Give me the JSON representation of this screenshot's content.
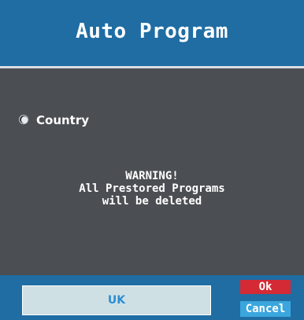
{
  "dialog": {
    "title": "Auto Program"
  },
  "options": {
    "country_label": "Country"
  },
  "warning": {
    "line1": "WARNING!",
    "line2": "All Prestored Programs",
    "line3": "will be deleted"
  },
  "footer": {
    "country_value": "UK",
    "ok_label": "Ok",
    "cancel_label": "Cancel"
  },
  "colors": {
    "title_bar": "#1f6da3",
    "body_panel": "#4b4e52",
    "ok_button": "#d42a35",
    "cancel_button": "#3ba6dd",
    "country_box": "#cfe0e4"
  }
}
